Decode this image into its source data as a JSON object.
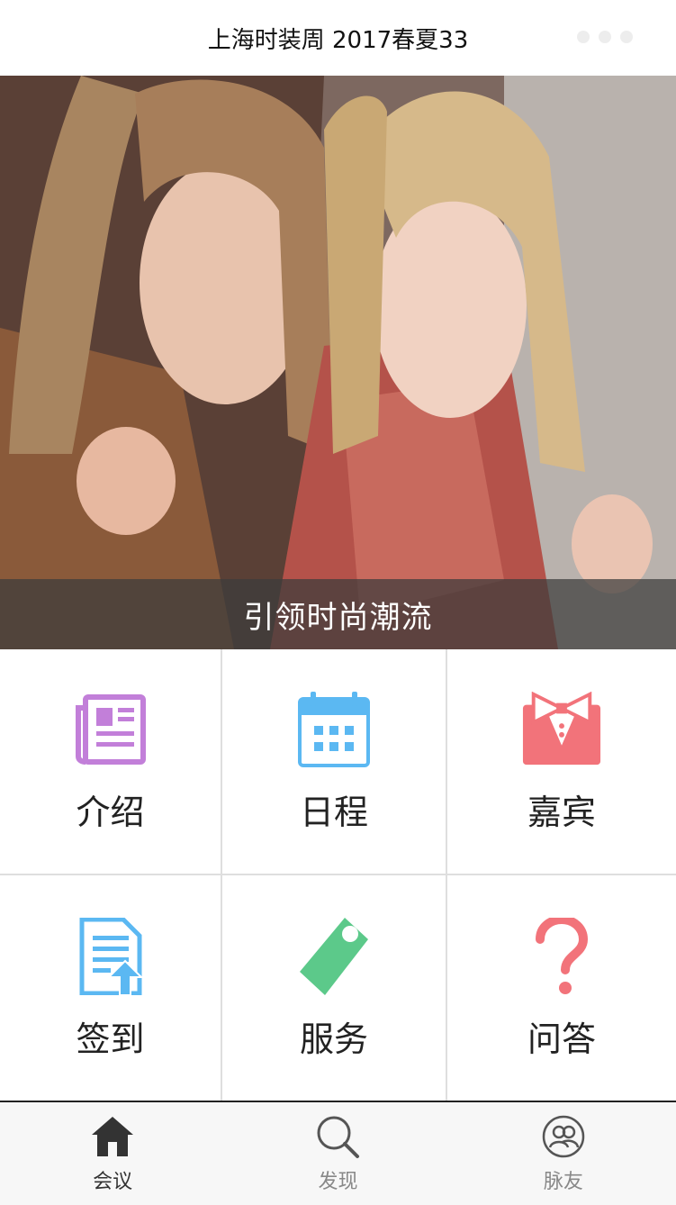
{
  "header": {
    "title": "上海时装周 2017春夏33"
  },
  "banner": {
    "caption": "引领时尚潮流"
  },
  "menu": [
    {
      "label": "介绍",
      "icon": "newspaper-icon",
      "color": "#c27fd9"
    },
    {
      "label": "日程",
      "icon": "calendar-icon",
      "color": "#5bb8f2"
    },
    {
      "label": "嘉宾",
      "icon": "bowtie-icon",
      "color": "#f2737a"
    },
    {
      "label": "签到",
      "icon": "signin-document-icon",
      "color": "#5bb8f2"
    },
    {
      "label": "服务",
      "icon": "tag-icon",
      "color": "#5cc98a"
    },
    {
      "label": "问答",
      "icon": "question-icon",
      "color": "#f2737a"
    }
  ],
  "tabbar": [
    {
      "label": "会议",
      "icon": "home-icon",
      "active": true
    },
    {
      "label": "发现",
      "icon": "search-icon",
      "active": false
    },
    {
      "label": "脉友",
      "icon": "contacts-icon",
      "active": false
    }
  ]
}
